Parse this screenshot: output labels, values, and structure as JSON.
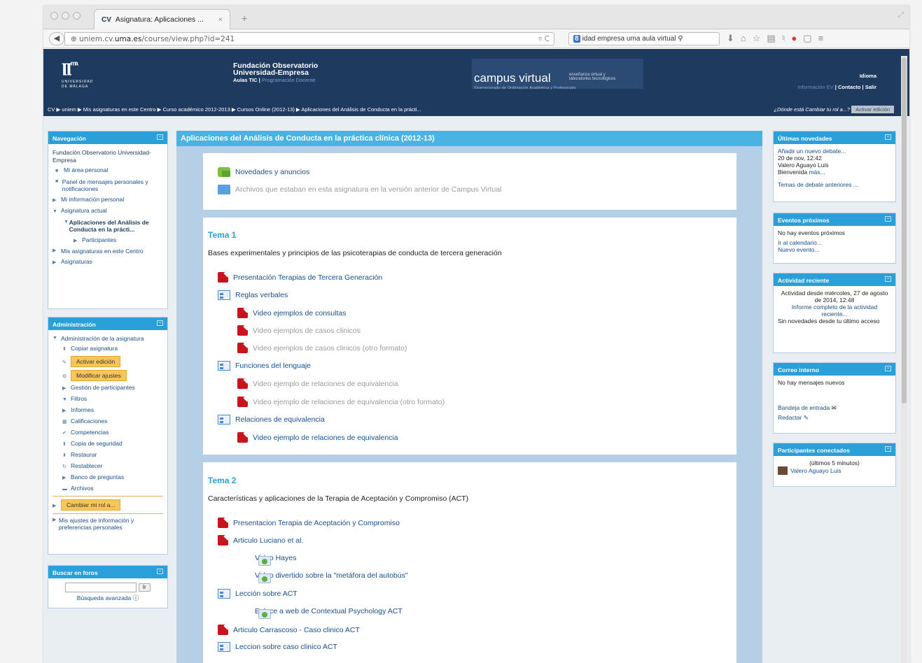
{
  "browser": {
    "tab_title": "Asignatura: Aplicaciones ...",
    "tab_favicon": "CV",
    "url_prefix": "uniem.cv.",
    "url_domain": "uma.es",
    "url_path": "/course/view.php?id=241",
    "search_text": "idad empresa uma aula virtual"
  },
  "banner": {
    "logo_mark": "ma",
    "logo_university": "UNIVERSIDAD\nDE MÁLAGA",
    "fund_line1": "Fundación Observatorio",
    "fund_line2": "Universidad-Empresa",
    "fund_sub1": "Aulas TIC",
    "fund_sub2": "Programación Docente",
    "campus_title": "campus virtual",
    "campus_small1": "enseñanza virtual y",
    "campus_small2": "laboratorios tecnológicos",
    "campus_vice": "Vicerrectorado de Ordenación Académica y Profesorado",
    "idioma": "Idioma",
    "info": "Información EV",
    "contacto": "Contacto",
    "salir": "Salir"
  },
  "breadcrumb": {
    "path": "CV ▶ uniem ▶ Mis asignaturas en este Centro ▶ Curso académico 2012-2013 ▶ Cursos Online (2012-13) ▶ Aplicaciones del Análisis de Conducta en la prácti...",
    "role_question": "¿Dónde está Cambiar tu rol a...?",
    "edit_button": "Activar edición"
  },
  "nav": {
    "header": "Navegación",
    "root": "Fundación Observatorio Universidad-Empresa",
    "items": [
      "Mi área personal",
      "Panel de mensajes personales y notificaciones",
      "Mi información personal",
      "Asignatura actual",
      "Aplicaciones del Análisis de Conducta en la prácti...",
      "Participantes",
      "Mis asignaturas en este Centro",
      "Asignaturas"
    ]
  },
  "admin": {
    "header": "Administración",
    "items": [
      "Administración de la asignatura",
      "Copiar asignatura",
      "Activar edición",
      "Modificar ajustes",
      "Gestión de participantes",
      "Filtros",
      "Informes",
      "Calificaciones",
      "Competencias",
      "Copia de seguridad",
      "Restaurar",
      "Restablecer",
      "Banco de preguntas",
      "Archivos",
      "Cambiar mi rol a...",
      "Mis ajustes de información y preferencias personales"
    ]
  },
  "forum_search": {
    "header": "Buscar en foros",
    "go": "Ir",
    "advanced": "Búsqueda avanzada"
  },
  "main": {
    "header": "Aplicaciones del Análisis de Conducta en la práctica clínica (2012-13)",
    "section0": [
      "Novedades y anuncios",
      "Archivos que estaban en esta asignatura en la versión anterior de Campus Virtual"
    ],
    "tema1": {
      "title": "Tema 1",
      "summary": "Bases experimentales y principios de las psicoterapias de conducta de tercera generación",
      "items": [
        "Presentación Terapias de Tercera Generación",
        "Reglas verbales",
        "Video ejemplos de consultas",
        "Video ejemplos de casos clinicos",
        "Video ejemplos de casos clinicos (otro formato)",
        "Funciones del lenguaje",
        "Video ejemplo de relaciones de equivalencia",
        "Video ejemplo de relaciones de equivalencia (otro formato)",
        "Relaciones de equivalencia",
        "Video ejemplo de relaciones de equivalencia"
      ]
    },
    "tema2": {
      "title": "Tema 2",
      "summary": "Características y aplicaciones de la Terapia de Aceptación y Compromiso (ACT)",
      "items": [
        "Presentacion Terapia de Aceptación y Compromiso",
        "Articulo Luciano et al.",
        "Video Hayes",
        "Video divertido sobre la \"metáfora del autobús\"",
        "Lección sobre ACT",
        "Enlace a web de Contextual Psychology ACT",
        "Articulo Carrascoso - Caso clinico ACT",
        "Leccion sobre caso clinico ACT"
      ]
    }
  },
  "right": {
    "news_header": "Últimas novedades",
    "news_link": "Añadir un nuevo debate...",
    "news_date": "20 de nov, 12:42",
    "news_author": "Valero Aguayo Luis",
    "news_text": "Bienvenida",
    "news_more": "más...",
    "news_old": "Temas de debate anteriores ...",
    "events_header": "Eventos próximos",
    "events_none": "No hay eventos próximos",
    "events_cal": "Ir al calendario...",
    "events_new": "Nuevo evento...",
    "activity_header": "Actividad reciente",
    "activity_since": "Actividad desde miércoles, 27 de agosto de 2014, 12:48",
    "activity_report": "Informe completo de la actividad reciente...",
    "activity_none": "Sin novedades desde tu último acceso",
    "mail_header": "Correo interno",
    "mail_none": "No hay mensajes nuevos",
    "mail_inbox": "Bandeja de entrada",
    "mail_compose": "Redactar",
    "online_header": "Participantes conectados",
    "online_window": "(últimos 5 minutos)",
    "online_user": "Valero Aguayo Luis"
  }
}
